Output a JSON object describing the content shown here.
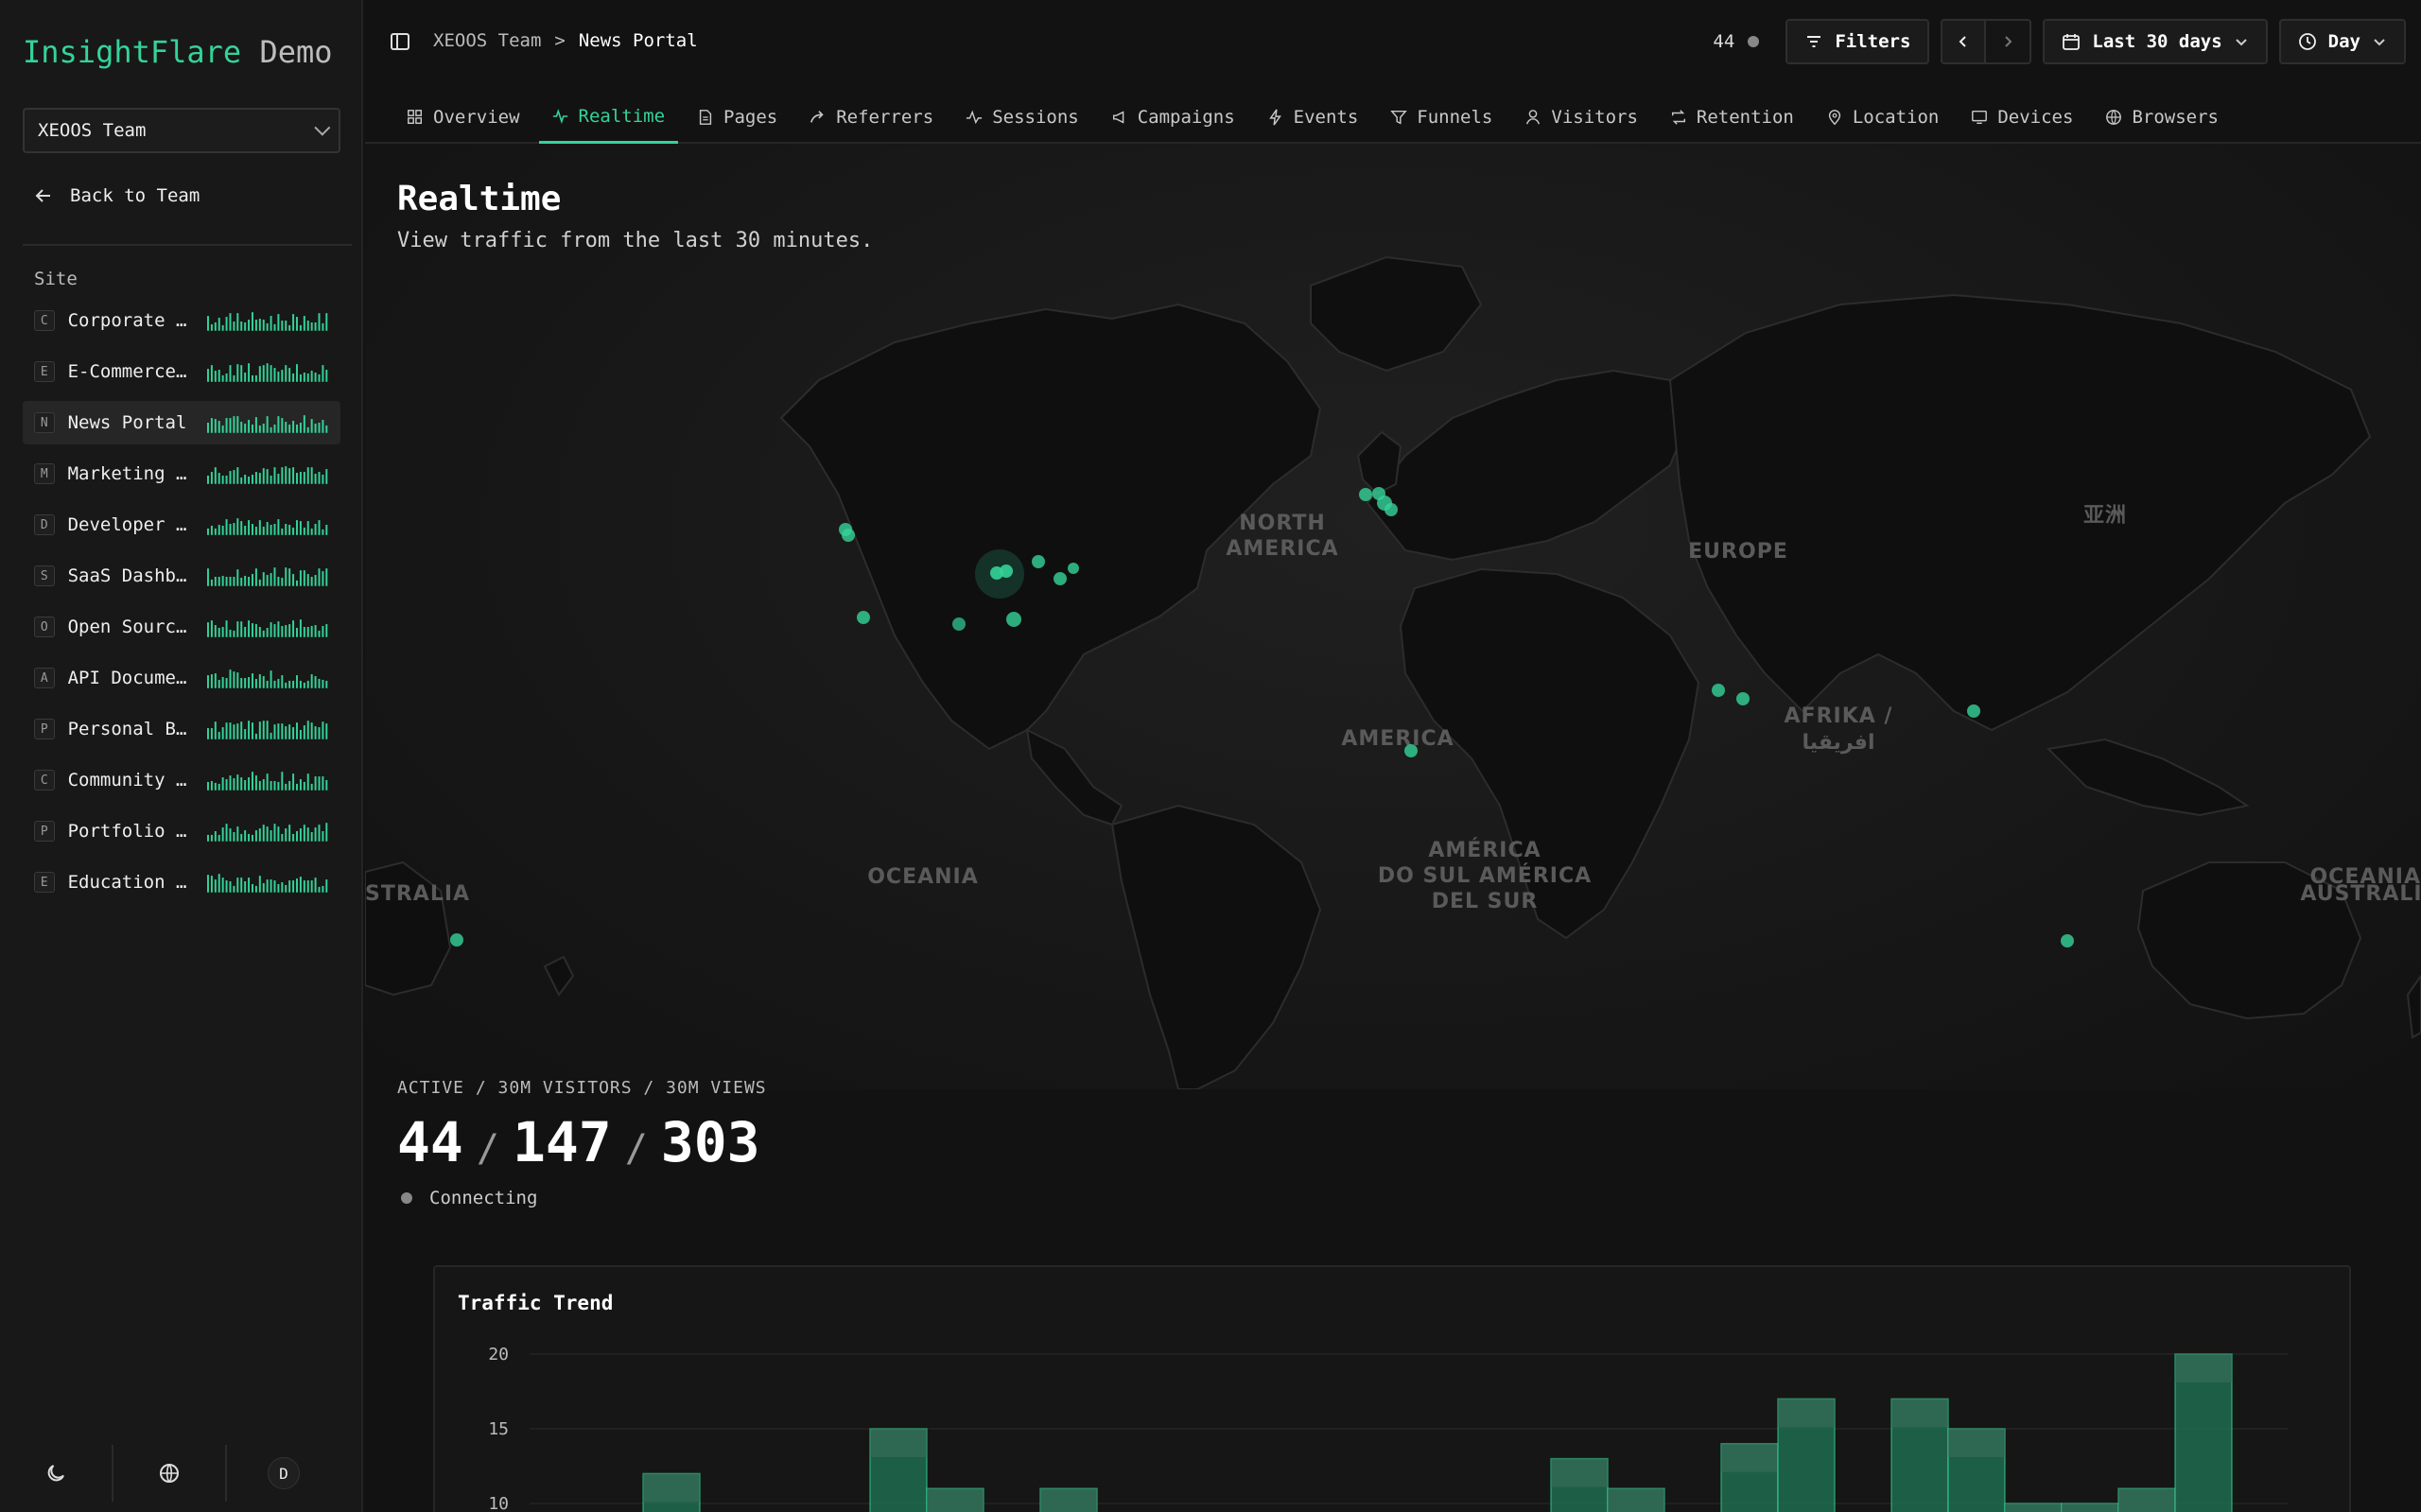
{
  "brand": {
    "name_accent": "InsightFlare",
    "name_rest": " Demo"
  },
  "team_select": {
    "value": "XEOOS Team"
  },
  "nav": {
    "back": "Back to Team",
    "site_label": "Site"
  },
  "sites": [
    {
      "letter": "C",
      "name": "Corporate W…",
      "active": false
    },
    {
      "letter": "E",
      "name": "E-Commerce …",
      "active": false
    },
    {
      "letter": "N",
      "name": "News Portal",
      "active": true
    },
    {
      "letter": "M",
      "name": "Marketing L…",
      "active": false
    },
    {
      "letter": "D",
      "name": "Developer D…",
      "active": false
    },
    {
      "letter": "S",
      "name": "SaaS Dashbo…",
      "active": false
    },
    {
      "letter": "O",
      "name": "Open Source…",
      "active": false
    },
    {
      "letter": "A",
      "name": "API Documen…",
      "active": false
    },
    {
      "letter": "P",
      "name": "Personal Bl…",
      "active": false
    },
    {
      "letter": "C",
      "name": "Community F…",
      "active": false
    },
    {
      "letter": "P",
      "name": "Portfolio S…",
      "active": false
    },
    {
      "letter": "E",
      "name": "Education P…",
      "active": false
    }
  ],
  "footer": {
    "avatar": "D",
    "icons": [
      "moon-icon",
      "globe-icon"
    ]
  },
  "breadcrumb": {
    "team": "XEOOS Team",
    "separator": ">",
    "site": "News Portal"
  },
  "topbar": {
    "count": "44",
    "filters": "Filters",
    "range": "Last 30 days",
    "granularity": "Day"
  },
  "tabs": [
    {
      "label": "Overview",
      "icon": "grid-icon",
      "active": false
    },
    {
      "label": "Realtime",
      "icon": "activity-icon",
      "active": true
    },
    {
      "label": "Pages",
      "icon": "file-icon",
      "active": false
    },
    {
      "label": "Referrers",
      "icon": "share-icon",
      "active": false
    },
    {
      "label": "Sessions",
      "icon": "pulse-icon",
      "active": false
    },
    {
      "label": "Campaigns",
      "icon": "megaphone-icon",
      "active": false
    },
    {
      "label": "Events",
      "icon": "bolt-icon",
      "active": false
    },
    {
      "label": "Funnels",
      "icon": "funnel-icon",
      "active": false
    },
    {
      "label": "Visitors",
      "icon": "user-icon",
      "active": false
    },
    {
      "label": "Retention",
      "icon": "repeat-icon",
      "active": false
    },
    {
      "label": "Location",
      "icon": "pin-icon",
      "active": false
    },
    {
      "label": "Devices",
      "icon": "monitor-icon",
      "active": false
    },
    {
      "label": "Browsers",
      "icon": "globe-icon",
      "active": false
    }
  ],
  "page": {
    "title": "Realtime",
    "subtitle": "View traffic from the last 30 minutes."
  },
  "map": {
    "labels": [
      "NORTH",
      "AMERICA",
      "EUROPE",
      "亚洲",
      "AFRIKA /",
      "افريقيا",
      "AMERICA",
      "AMÉRICA",
      "DO SUL AMÉRICA",
      "DEL SUR",
      "OCEANIA",
      "OCEANIA",
      "STRALIA",
      "AUSTRALIA"
    ]
  },
  "stats": {
    "caption": "ACTIVE / 30M VISITORS / 30M VIEWS",
    "active": "44",
    "visitors": "147",
    "views": "303",
    "separator": "/",
    "status": "Connecting"
  },
  "colors": {
    "accent": "#34d399",
    "bar_fill": "#1f6b4f",
    "bar_top": "#3a6e5a"
  },
  "chart_data": {
    "type": "bar",
    "title": "Traffic Trend",
    "y_ticks": [
      "20",
      "15",
      "10"
    ],
    "ylim": [
      0,
      20
    ],
    "series": [
      {
        "values": [
          0,
          0,
          12,
          0,
          0,
          0,
          15,
          11,
          0,
          11,
          0,
          0,
          0,
          0,
          0,
          0,
          0,
          0,
          13,
          11,
          0,
          14,
          17,
          0,
          17,
          15,
          10,
          10,
          11,
          20,
          0
        ]
      }
    ]
  }
}
